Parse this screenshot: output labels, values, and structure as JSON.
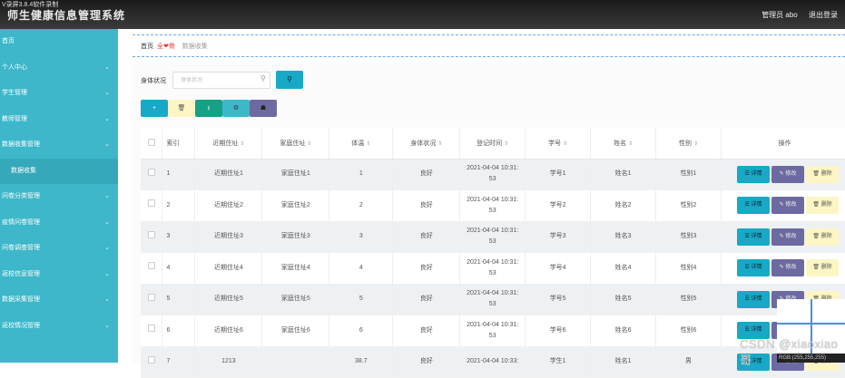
{
  "recorder_label": "V录屏3.8.4软件录制",
  "app_title": "师生健康信息管理系统",
  "header": {
    "user": "管理员 abo",
    "logout": "退出登录"
  },
  "sidebar": {
    "items": [
      {
        "label": "首页",
        "chevron": false
      },
      {
        "label": "个人中心",
        "chevron": true
      },
      {
        "label": "学生管理",
        "chevron": true
      },
      {
        "label": "教师管理",
        "chevron": true
      },
      {
        "label": "数据收集管理",
        "chevron": true
      },
      {
        "label": "数据收集",
        "chevron": false,
        "sub": true
      },
      {
        "label": "问卷分类管理",
        "chevron": true
      },
      {
        "label": "疫情问卷管理",
        "chevron": true
      },
      {
        "label": "问卷调查管理",
        "chevron": true
      },
      {
        "label": "返校信息管理",
        "chevron": true
      },
      {
        "label": "数据采集管理",
        "chevron": true
      },
      {
        "label": "返校情况管理",
        "chevron": true
      }
    ]
  },
  "breadcrumb": {
    "home": "首页",
    "middle": "全❤骨",
    "current": "数据收集"
  },
  "search": {
    "label": "身体状况",
    "placeholder": "身体状况",
    "icon": "search-icon",
    "button_icon": "search-icon"
  },
  "actions": {
    "add": "+",
    "delete": "🗑",
    "import": "⭳",
    "export": "⚙",
    "chart": "☗"
  },
  "table": {
    "columns": [
      "索引",
      "近期住址",
      "家庭住址",
      "体温",
      "身体状况",
      "登记时间",
      "学号",
      "姓名",
      "性别",
      "操作"
    ],
    "sortable": [
      false,
      true,
      true,
      true,
      true,
      true,
      true,
      true,
      true,
      false
    ],
    "rows": [
      {
        "idx": "1",
        "recent": "近期住址1",
        "home": "家庭住址1",
        "temp": "1",
        "health": "良好",
        "time1": "2021-04-04 10:31:",
        "time2": "53",
        "sid": "学号1",
        "name": "姓名1",
        "gender": "性别1"
      },
      {
        "idx": "2",
        "recent": "近期住址2",
        "home": "家庭住址2",
        "temp": "2",
        "health": "良好",
        "time1": "2021-04-04 10:31:",
        "time2": "53",
        "sid": "学号2",
        "name": "姓名2",
        "gender": "性别2"
      },
      {
        "idx": "3",
        "recent": "近期住址3",
        "home": "家庭住址3",
        "temp": "3",
        "health": "良好",
        "time1": "2021-04-04 10:31:",
        "time2": "53",
        "sid": "学号3",
        "name": "姓名3",
        "gender": "性别3"
      },
      {
        "idx": "4",
        "recent": "近期住址4",
        "home": "家庭住址4",
        "temp": "4",
        "health": "良好",
        "time1": "2021-04-04 10:31:",
        "time2": "53",
        "sid": "学号4",
        "name": "姓名4",
        "gender": "性别4"
      },
      {
        "idx": "5",
        "recent": "近期住址5",
        "home": "家庭住址5",
        "temp": "5",
        "health": "良好",
        "time1": "2021-04-04 10:31:",
        "time2": "53",
        "sid": "学号5",
        "name": "姓名5",
        "gender": "性别5"
      },
      {
        "idx": "6",
        "recent": "近期住址6",
        "home": "家庭住址6",
        "temp": "6",
        "health": "良好",
        "time1": "2021-04-04 10:31:",
        "time2": "53",
        "sid": "学号6",
        "name": "姓名6",
        "gender": "性别6"
      },
      {
        "idx": "7",
        "recent": "1213",
        "home": "",
        "temp": "38.7",
        "health": "良好",
        "time1": "2021-04-04 10:33:",
        "time2": "",
        "sid": "学生1",
        "name": "姓名1",
        "gender": "男"
      }
    ],
    "op_labels": {
      "detail": "详情",
      "edit": "修改",
      "delete": "删除"
    }
  },
  "overlay": {
    "pixel_readout": "RGB:(255,255,255)"
  },
  "watermark": "CSDN @xiaoxiao哥",
  "colors": {
    "sidebar": "#3db7c9",
    "primary": "#17a9c5",
    "edit": "#6c6aa0",
    "delete": "#fdf6c4",
    "import": "#16a085"
  }
}
